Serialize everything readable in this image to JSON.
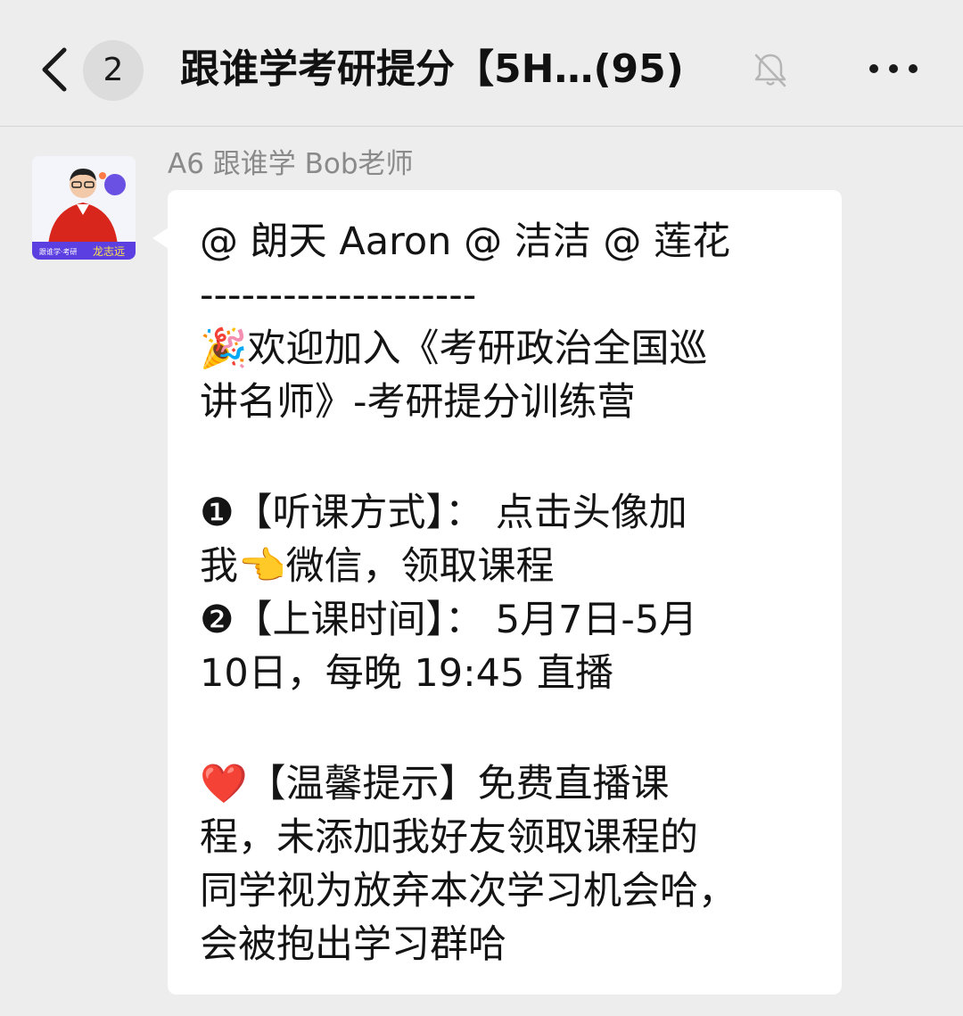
{
  "header": {
    "unread_count": "2",
    "title": "跟谁学考研提分【5H…(95)"
  },
  "icons": {
    "back": "chevron-left-icon",
    "mute": "bell-muted-icon",
    "more": "more-horizontal-icon",
    "avatar": "teacher-avatar"
  },
  "message": {
    "sender": "A6 跟谁学 Bob老师",
    "avatar_caption": "龙志远",
    "lines": [
      "@ 朗天 Aaron @ 洁洁 @ 莲花",
      "--------------------",
      "🎉欢迎加入《考研政治全国巡",
      "讲名师》-考研提分训练营",
      "",
      "❶【听课方式】： 点击头像加",
      "我👈微信，领取课程",
      "❷【上课时间】： 5月7日-5月",
      "10日，每晚 19:45 直播",
      "",
      "❤️【温馨提示】免费直播课",
      "程，未添加我好友领取课程的",
      "同学视为放弃本次学习机会哈，",
      "会被抱出学习群哈"
    ]
  },
  "colors": {
    "background": "#ededed",
    "bubble": "#ffffff",
    "sender_name": "#8a8a8a",
    "avatar_accent": "#d9261c",
    "avatar_badge": "#5b3fe0"
  }
}
